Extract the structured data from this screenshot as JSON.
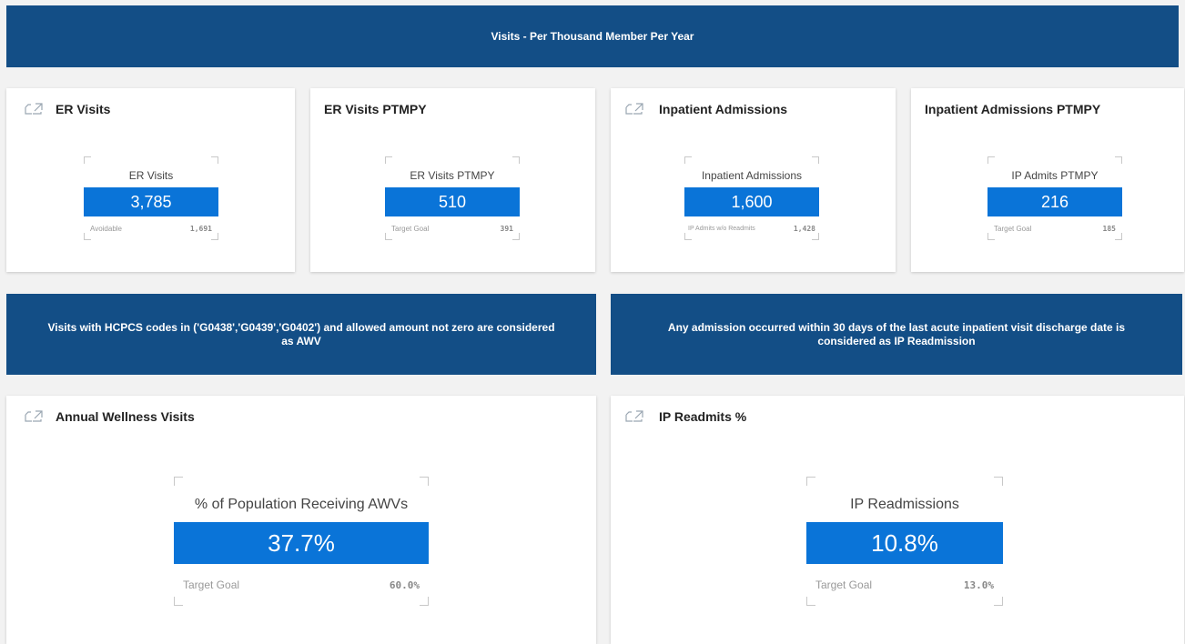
{
  "header": {
    "title": "Visits - Per Thousand Member Per Year"
  },
  "cards": {
    "er_visits": {
      "title": "ER Visits",
      "kpi_label": "ER Visits",
      "kpi_value": "3,785",
      "foot_label": "Avoidable",
      "foot_value": "1,691",
      "icon": "link-icon"
    },
    "er_ptmpy": {
      "title": "ER Visits PTMPY",
      "kpi_label": "ER Visits PTMPY",
      "kpi_value": "510",
      "foot_label": "Target Goal",
      "foot_value": "391"
    },
    "ip_admissions": {
      "title": "Inpatient Admissions",
      "kpi_label": "Inpatient Admissions",
      "kpi_value": "1,600",
      "foot_label": "IP Admits w/o Readmits",
      "foot_value": "1,428",
      "icon": "link-icon"
    },
    "ip_ptmpy": {
      "title": "Inpatient Admissions PTMPY",
      "kpi_label": "IP Admits PTMPY",
      "kpi_value": "216",
      "foot_label": "Target Goal",
      "foot_value": "185"
    },
    "awv": {
      "title": "Annual Wellness Visits",
      "kpi_label": "% of Population Receiving AWVs",
      "kpi_value": "37.7%",
      "foot_label": "Target Goal",
      "foot_value": "60.0%",
      "icon": "link-icon"
    },
    "ip_readmits": {
      "title": "IP Readmits %",
      "kpi_label": "IP Readmissions",
      "kpi_value": "10.8%",
      "foot_label": "Target Goal",
      "foot_value": "13.0%",
      "icon": "link-icon"
    }
  },
  "notes": {
    "awv": "Visits with HCPCS codes in ('G0438','G0439','G0402')  and allowed amount not zero are considered as AWV",
    "readmission": "Any admission occurred within 30 days of the last acute inpatient visit discharge date is considered as IP Readmission"
  },
  "colors": {
    "banner": "#134e86",
    "kpi_fill": "#0a74d8"
  }
}
